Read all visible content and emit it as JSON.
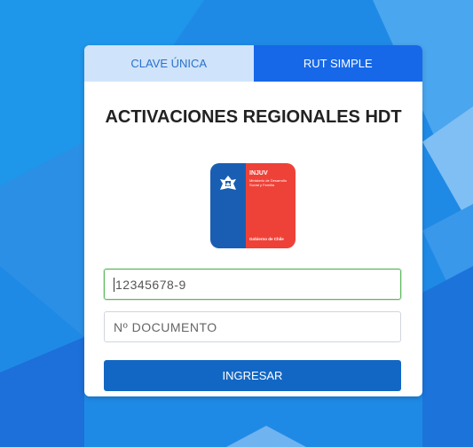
{
  "tabs": [
    {
      "label": "CLAVE ÚNICA",
      "active": false
    },
    {
      "label": "RUT SIMPLE",
      "active": true
    }
  ],
  "card": {
    "title": "ACTIVACIONES REGIONALES HDT"
  },
  "logo": {
    "brand": "INJUV",
    "ministry": "Ministerio de Desarrollo Social y Familia",
    "government": "Gobierno de Chile"
  },
  "form": {
    "rut_value": "12345678-9",
    "document_placeholder": "Nº DOCUMENTO",
    "submit_label": "INGRESAR"
  },
  "colors": {
    "background": "#1e88e5",
    "accent": "#1668e8",
    "tab_inactive": "#cfe3fb",
    "button": "#1367c4",
    "valid_border": "#5cb85c"
  }
}
